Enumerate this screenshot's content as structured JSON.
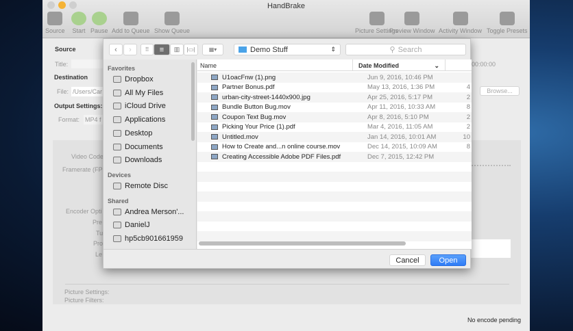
{
  "app": {
    "title": "HandBrake",
    "toolbar": [
      {
        "label": "Source",
        "icon": "clapperboard-icon"
      },
      {
        "label": "Start",
        "icon": "play-icon"
      },
      {
        "label": "Pause",
        "icon": "pause-icon"
      },
      {
        "label": "Add to Queue",
        "icon": "add-queue-icon"
      },
      {
        "label": "Show Queue",
        "icon": "queue-icon"
      },
      {
        "label": "Picture Settings",
        "icon": "tv-icon"
      },
      {
        "label": "Preview Window",
        "icon": "eye-icon"
      },
      {
        "label": "Activity Window",
        "icon": "terminal-icon"
      },
      {
        "label": "Toggle Presets",
        "icon": "sidebar-icon"
      }
    ],
    "source_label": "Source",
    "title_label": "Title:",
    "destination_label": "Destination",
    "file_label": "File:",
    "file_value": "/Users/Car",
    "output_label": "Output Settings:",
    "format_label": "Format:",
    "format_value": "MP4 f",
    "duration": "00:00:00",
    "browse_label": "Browse...",
    "video_codec_label": "Video Code",
    "framerate_label": "Framerate (FP:",
    "encoder_label": "Encoder Opti",
    "preset_label": "Pre",
    "tune_label": "Tu",
    "profile_label": "Pro",
    "level_label": "Le",
    "picture_settings_label": "Picture Settings:",
    "picture_filters_label": "Picture Filters:",
    "status": "No encode pending"
  },
  "dialog": {
    "location": "Demo Stuff",
    "search_placeholder": "Search",
    "sidebar": {
      "favorites_header": "Favorites",
      "favorites": [
        "Dropbox",
        "All My Files",
        "iCloud Drive",
        "Applications",
        "Desktop",
        "Documents",
        "Downloads"
      ],
      "devices_header": "Devices",
      "devices": [
        "Remote Disc"
      ],
      "shared_header": "Shared",
      "shared": [
        "Andrea  Merson'...",
        "DanielJ",
        "hp5cb901661959"
      ]
    },
    "columns": {
      "name": "Name",
      "date": "Date Modified"
    },
    "files": [
      {
        "name": "U1oacFnw (1).png",
        "date": "Jun 9, 2016, 10:46 PM",
        "size": ""
      },
      {
        "name": "Partner Bonus.pdf",
        "date": "May 13, 2016, 1:36 PM",
        "size": "4"
      },
      {
        "name": "urban-city-street-1440x900.jpg",
        "date": "Apr 25, 2016, 5:17 PM",
        "size": "2"
      },
      {
        "name": "Bundle Button Bug.mov",
        "date": "Apr 11, 2016, 10:33 AM",
        "size": "8"
      },
      {
        "name": "Coupon Text Bug.mov",
        "date": "Apr 8, 2016, 5:10 PM",
        "size": "2"
      },
      {
        "name": "Picking Your Price (1).pdf",
        "date": "Mar 4, 2016, 11:05 AM",
        "size": "2"
      },
      {
        "name": "Untitled.mov",
        "date": "Jan 14, 2016, 10:01 AM",
        "size": "10"
      },
      {
        "name": "How to Create and...n online course.mov",
        "date": "Dec 14, 2015, 10:09 AM",
        "size": "8"
      },
      {
        "name": "Creating Accessible Adobe PDF Files.pdf",
        "date": "Dec 7, 2015, 12:42 PM",
        "size": ""
      }
    ],
    "cancel_label": "Cancel",
    "open_label": "Open",
    "accent": "#2f7cf6"
  }
}
